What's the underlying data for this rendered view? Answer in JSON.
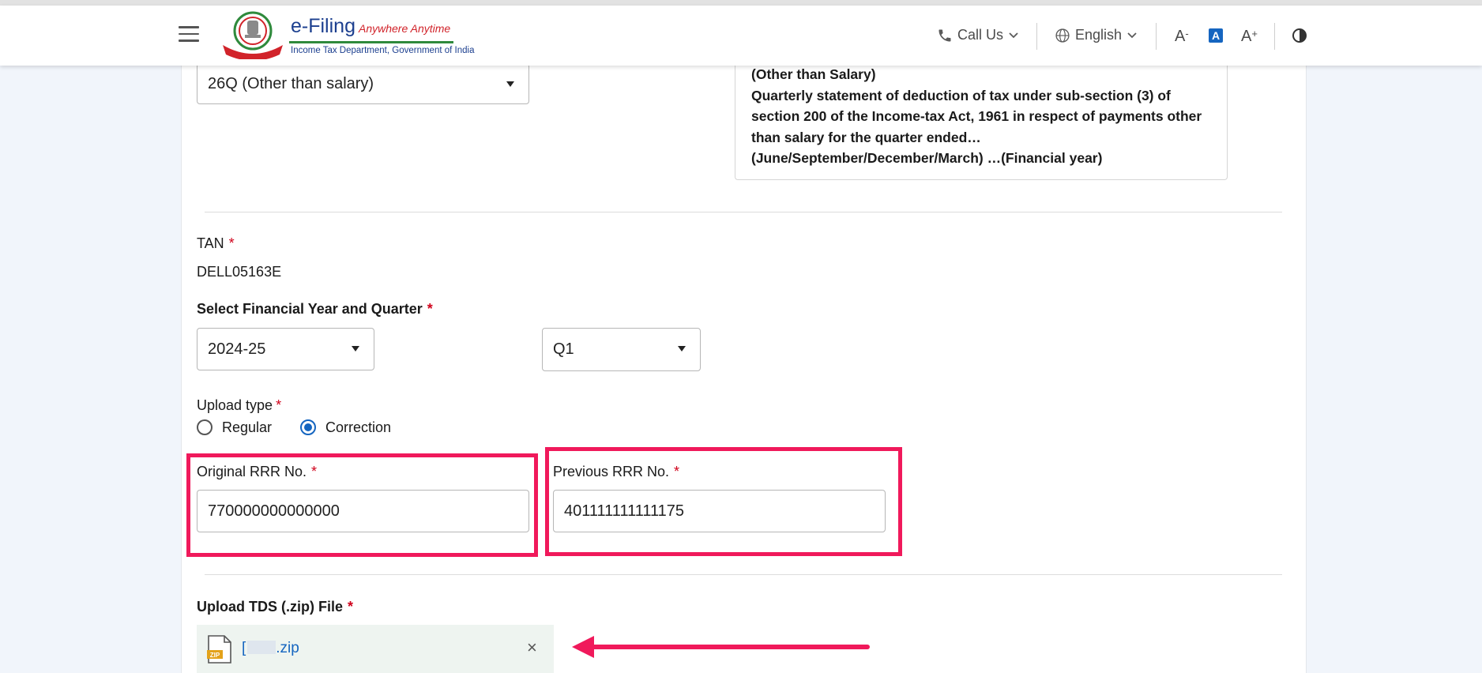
{
  "header": {
    "logo_title": "e-Filing",
    "logo_tagline": "Anywhere Anytime",
    "logo_subtitle": "Income Tax Department, Government of India",
    "call_us": "Call Us",
    "language": "English",
    "font_decrease": "A",
    "font_default": "A",
    "font_increase": "A"
  },
  "form": {
    "form_type_value": "26Q (Other than salary)",
    "form_info": {
      "title": "(Other than Salary)",
      "description": "Quarterly statement of deduction of tax under sub-section (3) of section 200 of the Income-tax Act, 1961 in respect of payments other than salary for the quarter ended… (June/September/December/March) …(Financial year)"
    },
    "tan_label": "TAN",
    "tan_value": "DELL05163E",
    "fy_quarter_label": "Select Financial Year and Quarter",
    "fy_value": "2024-25",
    "quarter_value": "Q1",
    "upload_type_label": "Upload type",
    "upload_type_options": [
      "Regular",
      "Correction"
    ],
    "upload_type_selected": "Correction",
    "original_rrr_label": "Original RRR No.",
    "original_rrr_value": "770000000000000",
    "previous_rrr_label": "Previous RRR No.",
    "previous_rrr_value": "401111111111175",
    "upload_file_label": "Upload TDS (.zip) File",
    "file_icon_text": "ZIP",
    "file_name_start": "[",
    "file_name_end": ".zip",
    "required_mark": "*"
  },
  "annotations": {
    "highlight_color": "#f0195b"
  }
}
